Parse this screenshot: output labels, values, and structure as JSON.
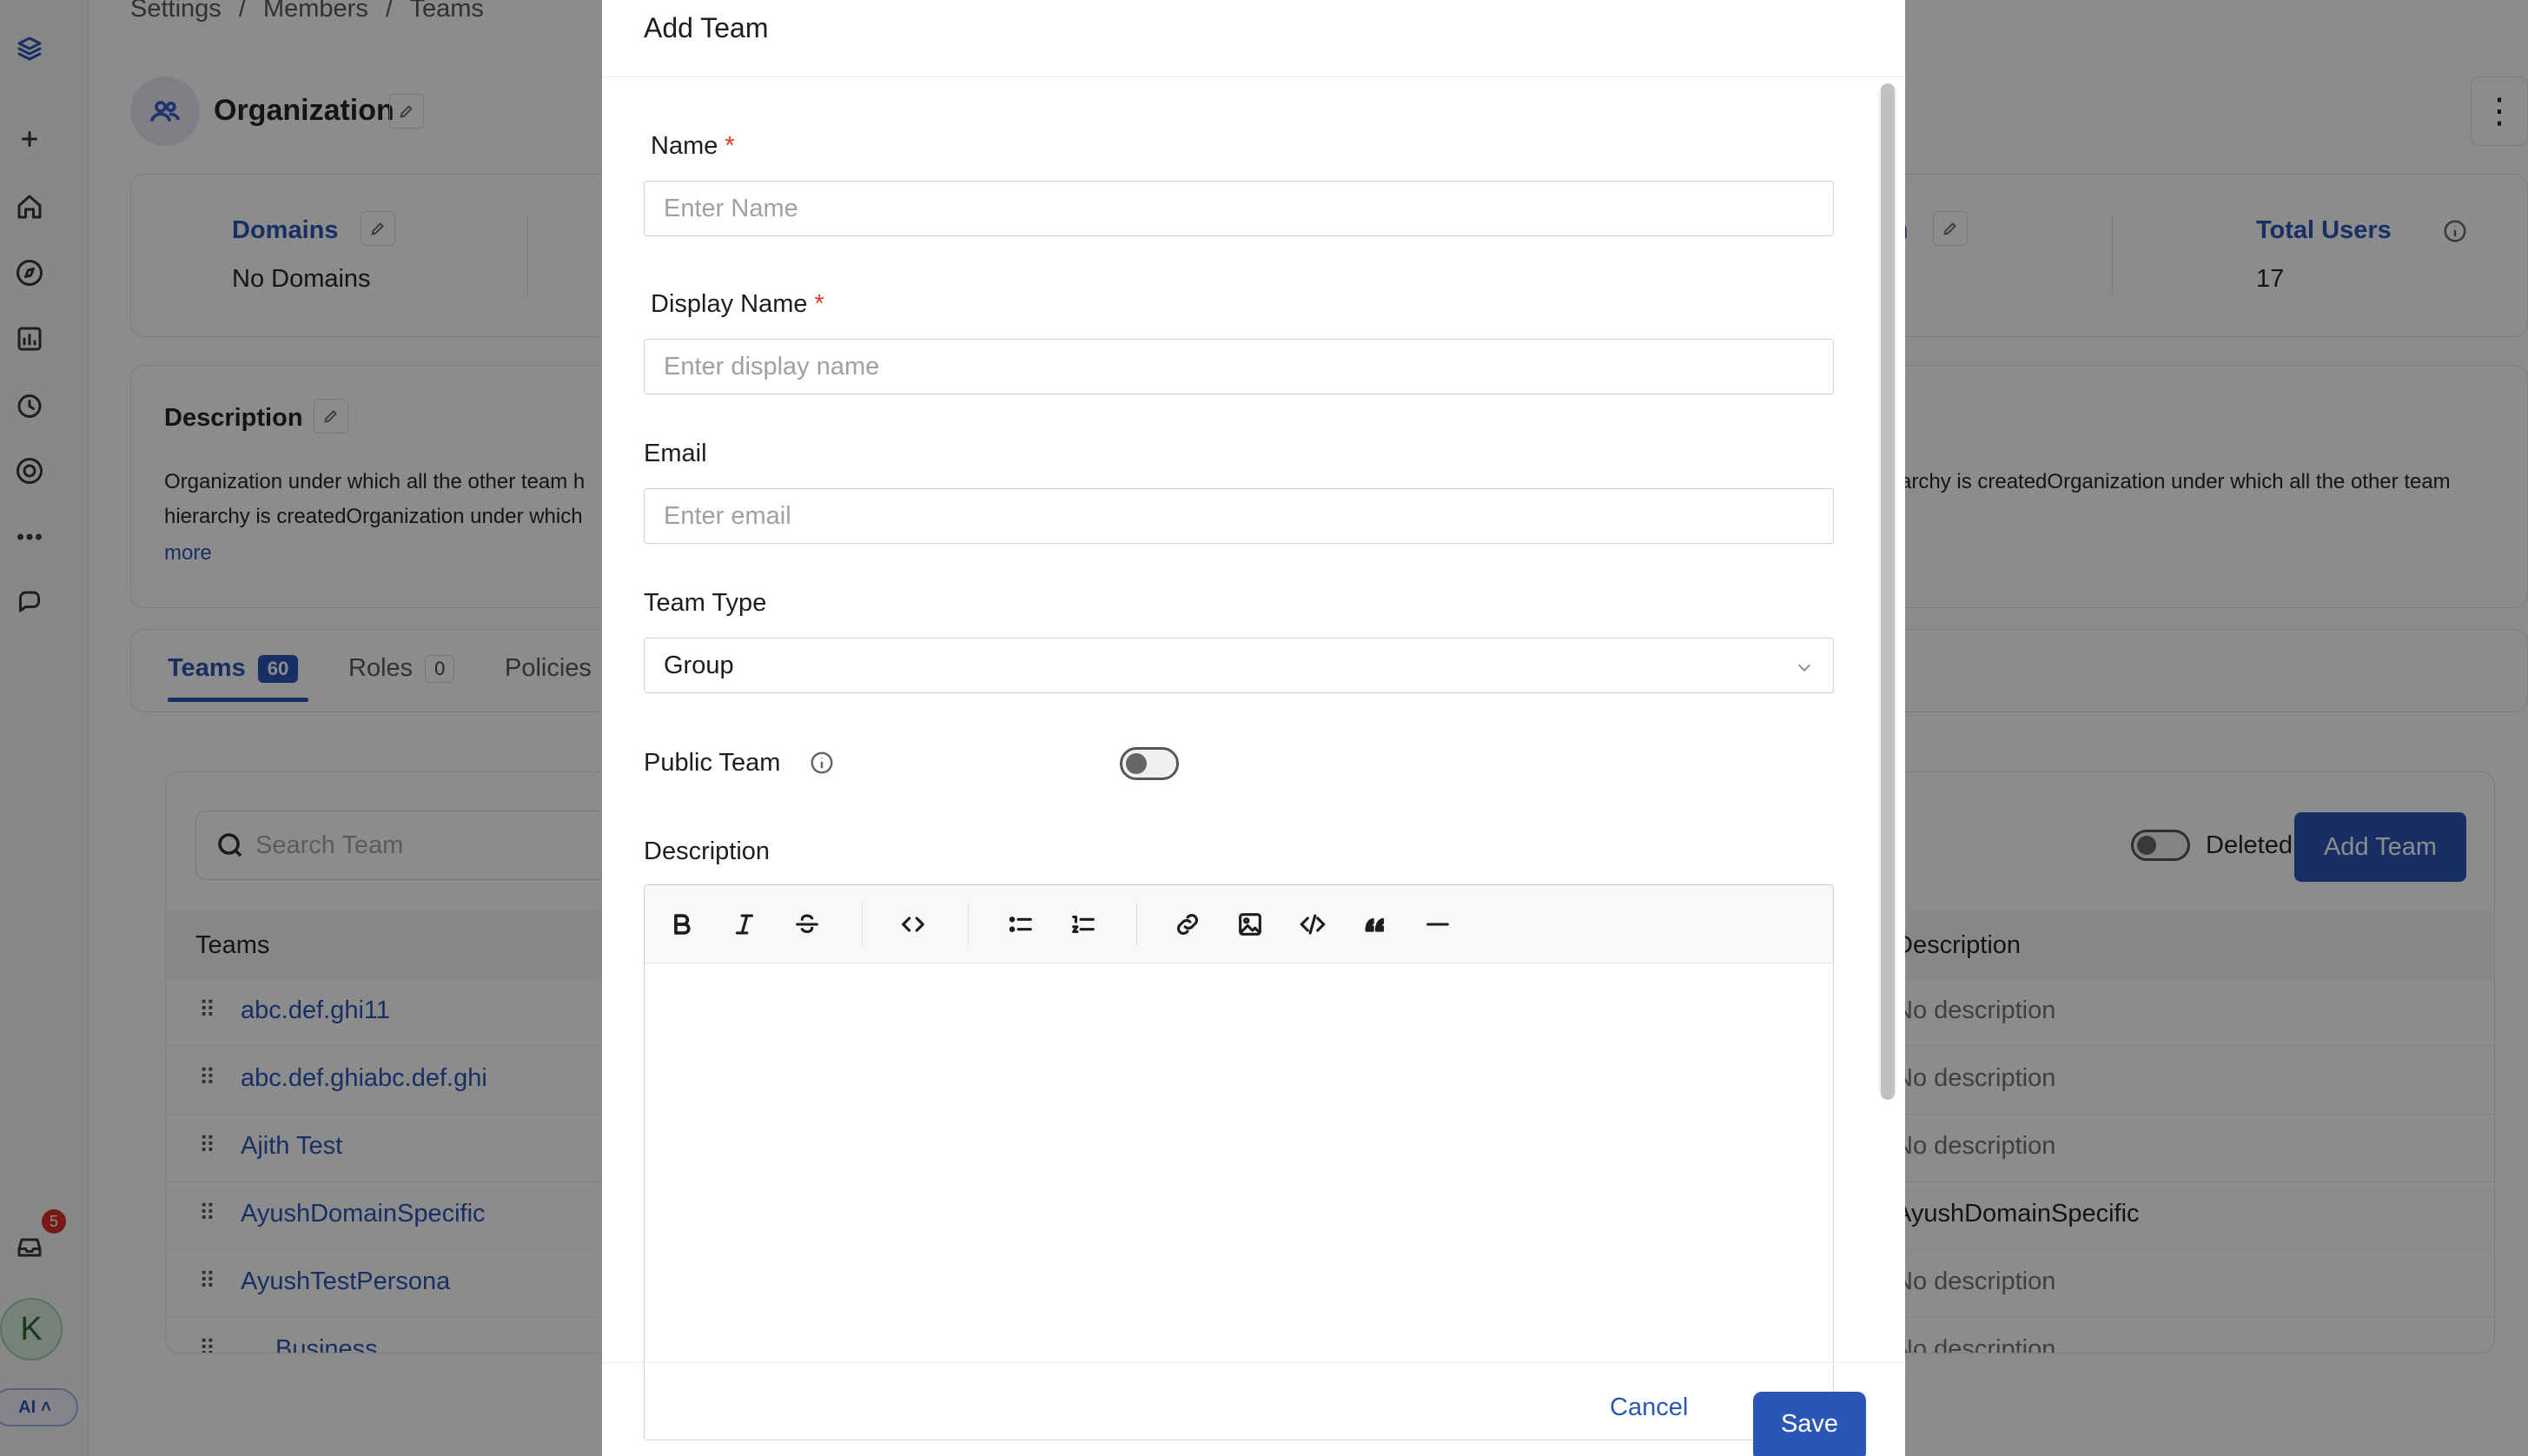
{
  "breadcrumb": {
    "items": [
      "Settings",
      "/",
      "Members",
      "/",
      "Teams"
    ]
  },
  "sidebar": {
    "notification_count": "5",
    "avatar_initial": "K",
    "ai_label": "AI"
  },
  "org": {
    "title": "Organization"
  },
  "stats": {
    "domains_label": "Domains",
    "domains_value": "No Domains",
    "partial_label": "on",
    "total_users_label": "Total Users",
    "total_users_value": "17"
  },
  "description": {
    "title": "Description",
    "left_line1": "Organization under which all the other team h",
    "left_line2": "hierarchy is createdOrganization under which",
    "right_line1": "archy is createdOrganization under which all the other team",
    "more": "more"
  },
  "tabs": [
    {
      "label": "Teams",
      "count": "60"
    },
    {
      "label": "Roles",
      "count": "0"
    },
    {
      "label": "Policies"
    }
  ],
  "table": {
    "search_placeholder": "Search Team",
    "deleted_label": "Deleted",
    "add_team_label": "Add Team",
    "col_teams": "Teams",
    "col_description": "Description",
    "rows": [
      {
        "name": "abc.def.ghi11",
        "description": "No description"
      },
      {
        "name": "abc.def.ghiabc.def.ghi",
        "description": "No description"
      },
      {
        "name": "Ajith Test",
        "description": "No description"
      },
      {
        "name": "AyushDomainSpecific",
        "description": "AyushDomainSpecific"
      },
      {
        "name": "AyushTestPersona",
        "description": "No description"
      },
      {
        "name": "Business",
        "description": "No description"
      }
    ]
  },
  "modal": {
    "title": "Add Team",
    "name_label": "Name",
    "name_placeholder": "Enter Name",
    "display_name_label": "Display Name",
    "display_name_placeholder": "Enter display name",
    "email_label": "Email",
    "email_placeholder": "Enter email",
    "team_type_label": "Team Type",
    "team_type_value": "Group",
    "public_team_label": "Public Team",
    "description_label": "Description",
    "required_mark": "*",
    "cancel_label": "Cancel",
    "save_label": "Save"
  },
  "colors": {
    "accent": "#2a57b6",
    "required": "#e0372a",
    "badge": "#d9312b"
  }
}
